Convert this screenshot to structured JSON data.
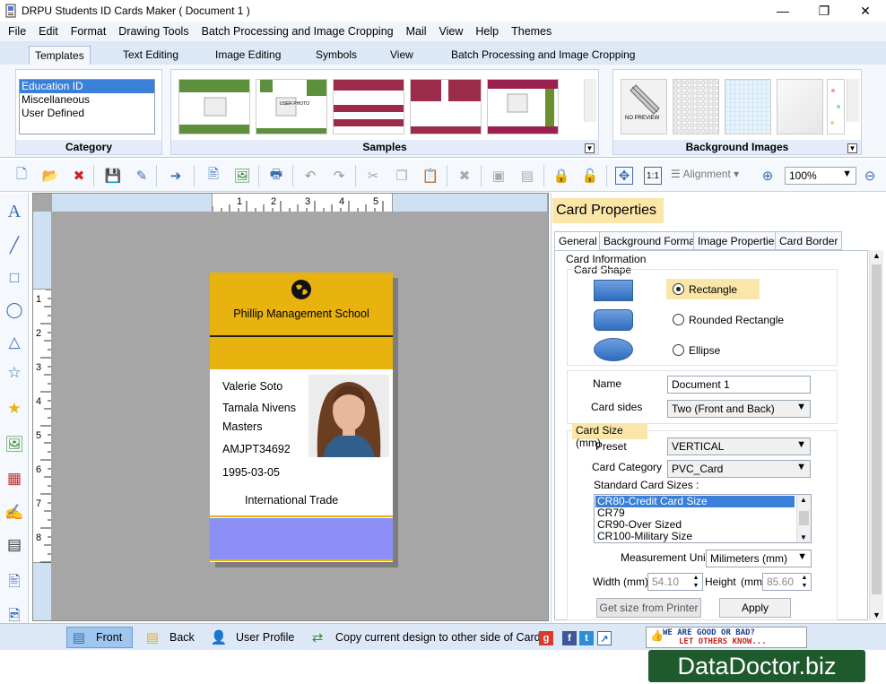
{
  "window": {
    "title": "DRPU Students ID Cards Maker ( Document 1 )"
  },
  "menu": [
    "File",
    "Edit",
    "Format",
    "Drawing Tools",
    "Batch Processing and Image Cropping",
    "Mail",
    "View",
    "Help",
    "Themes"
  ],
  "ribbon_tabs": [
    "Templates",
    "Text Editing",
    "Image Editing",
    "Symbols",
    "View",
    "Batch Processing and Image Cropping"
  ],
  "ribbon": {
    "category_label": "Category",
    "categories": [
      "Education ID",
      "Miscellaneous",
      "User Defined"
    ],
    "samples_label": "Samples",
    "background_label": "Background Images",
    "no_preview": "NO PREVIEW",
    "user_photo": "USER PHOTO"
  },
  "toolbar": {
    "alignment_label": "Alignment",
    "zoom_value": "100%"
  },
  "rulers": {
    "h": [
      "1",
      "2",
      "3",
      "4",
      "5"
    ],
    "v": [
      "1",
      "2",
      "3",
      "4",
      "5",
      "6",
      "7",
      "8"
    ]
  },
  "card": {
    "school": "Phillip Management School",
    "name": "Valerie Soto",
    "parent": "Tamala Nivens",
    "course": "Masters",
    "id": "AMJPT34692",
    "dob": "1995-03-05",
    "dept": "International Trade"
  },
  "panel": {
    "title": "Card Properties",
    "tabs": [
      "General",
      "Background Format",
      "Image Properties",
      "Card Border"
    ],
    "card_information": "Card Information",
    "card_shape": "Card Shape",
    "shapes": [
      "Rectangle",
      "Rounded Rectangle",
      "Ellipse"
    ],
    "name_label": "Name",
    "name_value": "Document 1",
    "sides_label": "Card sides",
    "sides_value": "Two (Front and Back)",
    "size_label": "Card Size (mm)",
    "preset_label": "Preset",
    "preset_value": "VERTICAL",
    "category_label": "Card Category",
    "category_value": "PVC_Card",
    "standard_label": "Standard Card Sizes :",
    "standard_sizes": [
      "CR80-Credit Card Size",
      "CR79",
      "CR90-Over Sized",
      "CR100-Military Size"
    ],
    "unit_label": "Measurement Unit :",
    "unit_value": "Milimeters (mm)",
    "width_label": "Width  (mm)",
    "width_value": "54.10",
    "height_label": "Height",
    "height_unit": "(mm)",
    "height_value": "85.60",
    "printer_btn": "Get size from Printer",
    "apply_btn": "Apply"
  },
  "statusbar": {
    "front": "Front",
    "back": "Back",
    "profile": "User Profile",
    "copy": "Copy current design to other side of Card",
    "feedback_top": "WE ARE GOOD OR BAD?",
    "feedback_bottom": "LET OTHERS KNOW..."
  },
  "brand": "DataDoctor.biz",
  "colors": {
    "card_header": "#e8b20f",
    "card_footer": "#8c8ff5",
    "brand_bg": "#1e5a2c"
  }
}
